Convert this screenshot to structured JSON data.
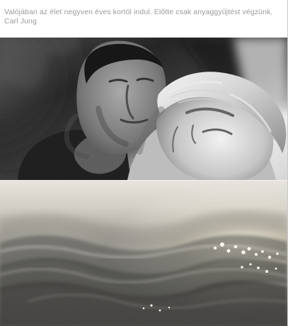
{
  "post": {
    "quote": "Valójában az élet negyven éves kortól indul. Előtte csak anyaggyűjtést végzünk.",
    "author": "Carl Jung"
  },
  "images": {
    "top": {
      "icon": "black-and-white-couple-photo"
    },
    "bottom": {
      "icon": "sparkling-water-waves-photo"
    }
  }
}
